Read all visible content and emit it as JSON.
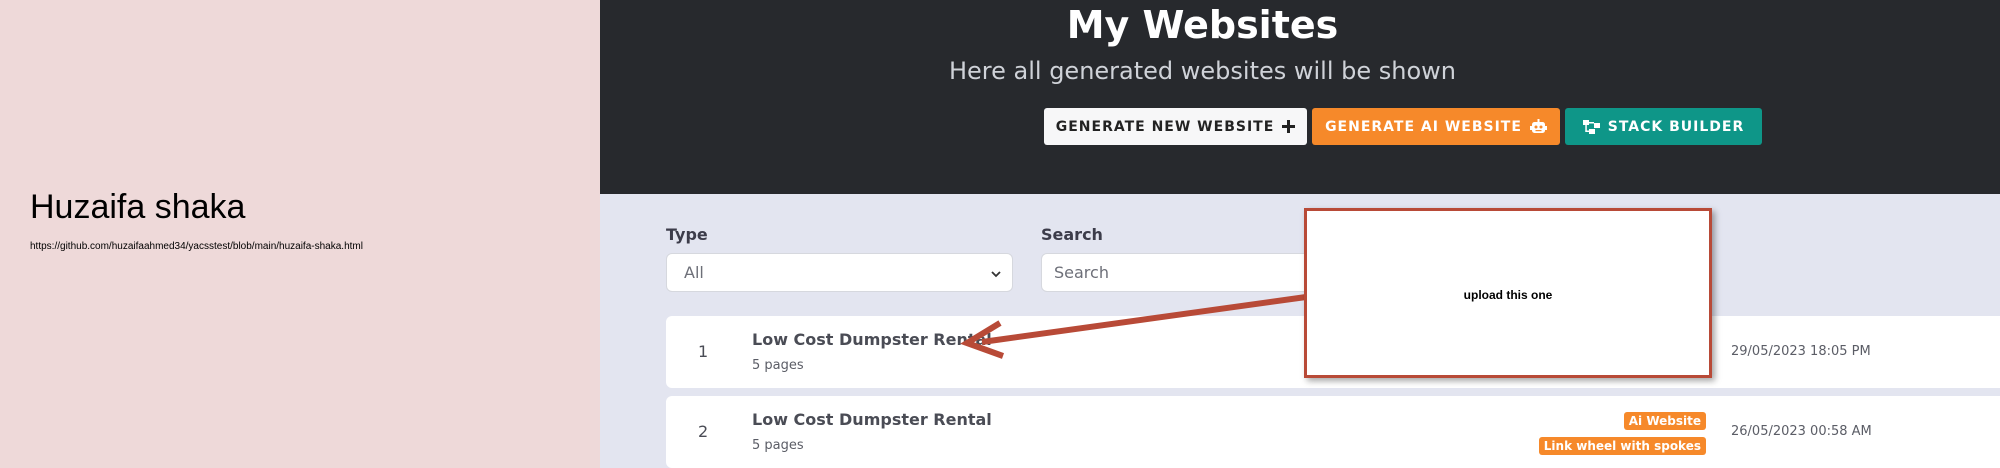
{
  "left_pane": {
    "title": "Huzaifa shaka",
    "url": "https://github.com/huzaifaahmed34/yacsstest/blob/main/huzaifa-shaka.html"
  },
  "header": {
    "title": "My Websites",
    "subtitle": "Here all generated websites will be shown",
    "buttons": {
      "generate_new": "GENERATE NEW WEBSITE",
      "generate_ai": "GENERATE AI WEBSITE",
      "stack_builder": "STACK BUILDER"
    }
  },
  "filters": {
    "type_label": "Type",
    "type_value": "All",
    "search_label": "Search",
    "search_placeholder": "Search"
  },
  "websites": [
    {
      "index": "1",
      "name": "Low Cost Dumpster Rental",
      "pages": "5 pages",
      "date": "29/05/2023 18:05 PM",
      "badges": []
    },
    {
      "index": "2",
      "name": "Low Cost Dumpster Rental",
      "pages": "5 pages",
      "date": "26/05/2023 00:58 AM",
      "badges": [
        "Ai Website",
        "Link wheel with spokes"
      ]
    }
  ],
  "annotation": {
    "text": "upload this one"
  },
  "colors": {
    "header_bg": "#27292d",
    "accent_orange": "#f6892a",
    "accent_teal": "#0e9688",
    "annotation_red": "#b84a37",
    "left_pane_bg": "#eed9d9"
  }
}
